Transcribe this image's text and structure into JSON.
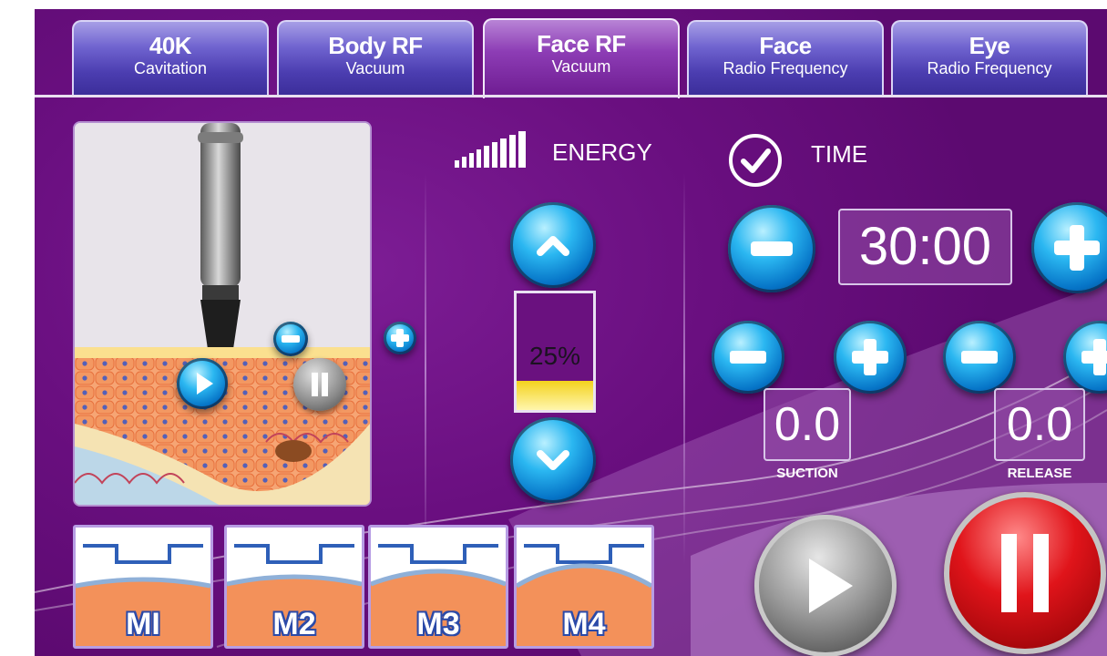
{
  "tabs": [
    {
      "title": "40K",
      "subtitle": "Cavitation",
      "active": false
    },
    {
      "title": "Body RF",
      "subtitle": "Vacuum",
      "active": false
    },
    {
      "title": "Face RF",
      "subtitle": "Vacuum",
      "active": true
    },
    {
      "title": "Face",
      "subtitle": "Radio Frequency",
      "active": false
    },
    {
      "title": "Eye",
      "subtitle": "Radio Frequency",
      "active": false
    }
  ],
  "energy": {
    "label": "ENERGY",
    "value_text": "25%",
    "level": 0.25
  },
  "time": {
    "label": "TIME",
    "value": "30:00"
  },
  "suction": {
    "value": "0.0",
    "label": "SUCTION"
  },
  "release": {
    "value": "0.0",
    "label": "RELEASE"
  },
  "modes": [
    {
      "label": "MI"
    },
    {
      "label": "M2"
    },
    {
      "label": "M3"
    },
    {
      "label": "M4"
    }
  ],
  "colors": {
    "background": "#6a0f80",
    "tab_inactive": "#4b3db0",
    "tab_active": "#8d3db5",
    "button_blue": "#2bb7f1",
    "pause_red": "#e0141a",
    "energy_fill": "#f3d21d"
  },
  "icons": [
    "signal-bars-icon",
    "check-circle-icon",
    "chevron-up-icon",
    "chevron-down-icon",
    "minus-icon",
    "plus-icon",
    "play-icon",
    "pause-icon"
  ]
}
